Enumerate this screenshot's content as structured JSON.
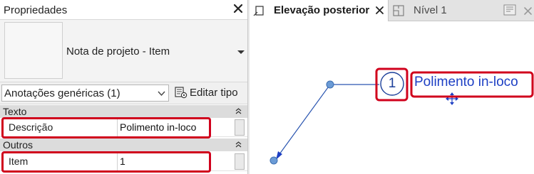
{
  "properties": {
    "title": "Propriedades",
    "type_name": "Nota de projeto - Item",
    "filter_value": "Anotações genéricas (1)",
    "edit_type_label": "Editar tipo",
    "groups": [
      {
        "label": "Texto",
        "rows": [
          {
            "name": "Descrição",
            "value": "Polimento in-loco"
          }
        ]
      },
      {
        "label": "Outros",
        "rows": [
          {
            "name": "Item",
            "value": "1"
          }
        ]
      }
    ]
  },
  "view": {
    "tabs": [
      {
        "label": "Elevação posterior",
        "active": true
      },
      {
        "label": "Nível 1",
        "active": false
      }
    ],
    "note": {
      "number": "1",
      "text": "Polimento in-loco"
    }
  },
  "colors": {
    "highlight": "#d0001c",
    "annotation_blue": "#1d3fc4",
    "leader_blue": "#2a55b0",
    "grip_blue": "#6b9bd6"
  }
}
